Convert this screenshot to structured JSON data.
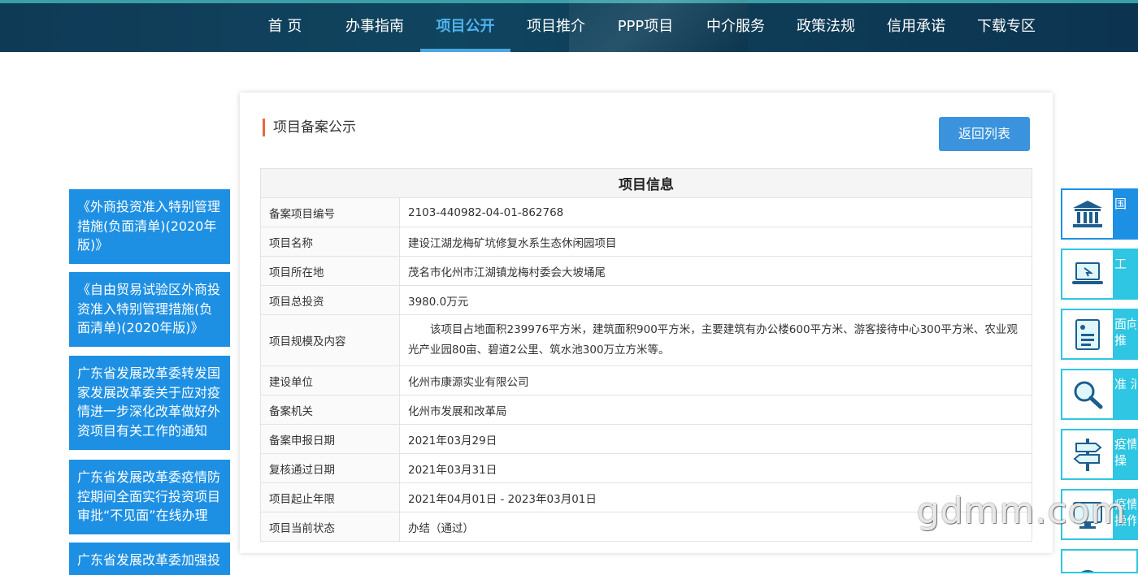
{
  "nav": {
    "items": [
      {
        "label": "首 页"
      },
      {
        "label": "办事指南"
      },
      {
        "label": "项目公开"
      },
      {
        "label": "项目推介"
      },
      {
        "label": "PPP项目"
      },
      {
        "label": "中介服务"
      },
      {
        "label": "政策法规"
      },
      {
        "label": "信用承诺"
      },
      {
        "label": "下载专区"
      }
    ],
    "active_index": 2
  },
  "left_links": [
    {
      "text": "《外商投资准入特别管理措施(负面清单)(2020年版)》"
    },
    {
      "text": "《自由贸易试验区外商投资准入特别管理措施(负面清单)(2020年版)》"
    },
    {
      "text": "广东省发展改革委转发国家发展改革委关于应对疫情进一步深化改革做好外资项目有关工作的通知"
    },
    {
      "text": "广东省发展改革委疫情防控期间全面实行投资项目审批“不见面”在线办理"
    },
    {
      "text": "广东省发展改革委加强投"
    }
  ],
  "main": {
    "section_title": "项目备案公示",
    "back_button": "返回列表",
    "table_title": "项目信息",
    "rows": [
      {
        "label": "备案项目编号",
        "value": "2103-440982-04-01-862768"
      },
      {
        "label": "项目名称",
        "value": "建设江湖龙梅矿坑修复水系生态休闲园项目"
      },
      {
        "label": "项目所在地",
        "value": "茂名市化州市江湖镇龙梅村委会大坡埇尾"
      },
      {
        "label": "项目总投资",
        "value": "3980.0万元"
      },
      {
        "label": "项目规模及内容",
        "value": "该项目占地面积239976平方米，建筑面积900平方米，主要建筑有办公楼600平方米、游客接待中心300平方米、农业观光产业园80亩、碧道2公里、筑水池300万立方米等。"
      },
      {
        "label": "建设单位",
        "value": "化州市康源实业有限公司"
      },
      {
        "label": "备案机关",
        "value": "化州市发展和改革局"
      },
      {
        "label": "备案申报日期",
        "value": "2021年03月29日"
      },
      {
        "label": "复核通过日期",
        "value": "2021年03月31日"
      },
      {
        "label": "项目起止年限",
        "value": "2021年04月01日 - 2023年03月01日"
      },
      {
        "label": "项目当前状态",
        "value": "办结（通过）"
      }
    ]
  },
  "side_widgets": [
    {
      "icon": "bank-icon",
      "text": "国"
    },
    {
      "icon": "laptop-icon",
      "text": "工"
    },
    {
      "icon": "document-icon",
      "text": "面向 推"
    },
    {
      "icon": "search-icon",
      "text": "准 清"
    },
    {
      "icon": "signpost-icon",
      "text": "疫情 操"
    },
    {
      "icon": "monitor-icon",
      "text": "疫情 操作"
    }
  ],
  "watermark": "gdmm.com",
  "colors": {
    "nav_bg": "#10455f",
    "nav_active": "#4fb3ef",
    "link_blue": "#1e90e4",
    "button_blue": "#3a93dc",
    "accent_orange": "#e5693f",
    "side_cyan": "#2ec6e2"
  }
}
